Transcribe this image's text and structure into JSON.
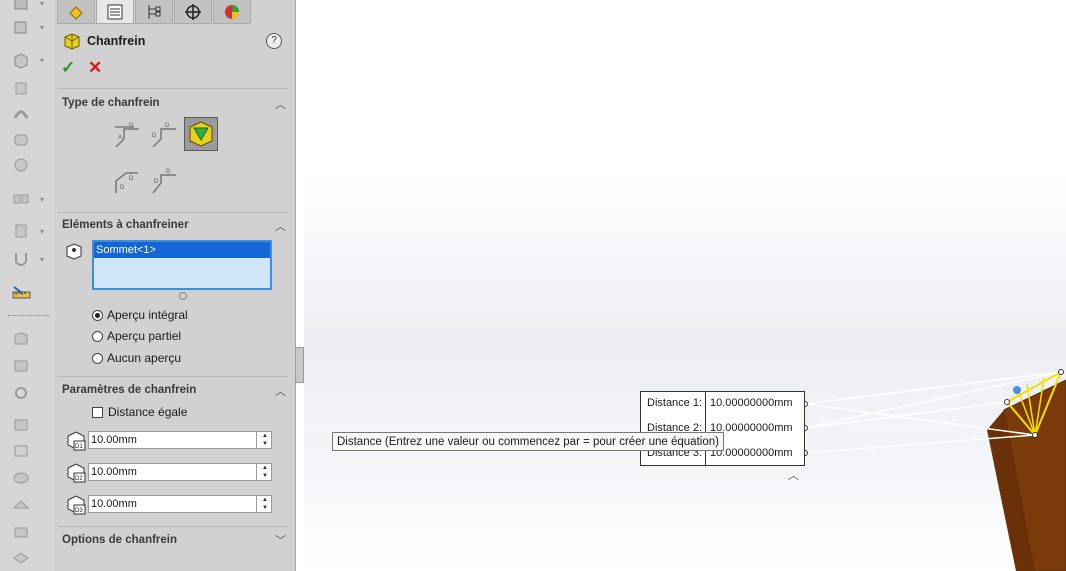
{
  "toolstrip": {
    "icons": [
      "part-icon",
      "box-icon",
      "extrude-icon",
      "revolve-icon",
      "sweep-icon",
      "fillet-icon",
      "pattern-icon",
      "rib-icon",
      "wrap-icon",
      "ruler-icon",
      "shell-icon",
      "draft-icon",
      "loft-icon",
      "hole-icon",
      "mirror-icon",
      "curve-icon",
      "reference-icon",
      "sheet-icon"
    ]
  },
  "tabs": [
    "feature-manager",
    "property-manager",
    "configuration-manager",
    "dimxpert-manager",
    "display-manager"
  ],
  "feature": {
    "title": "Chanfrein",
    "help": "?"
  },
  "sections": {
    "type": {
      "title": "Type de chanfrein"
    },
    "elements": {
      "title": "Eléments à chanfreiner",
      "items": [
        "Sommet<1>"
      ]
    },
    "preview": {
      "options": [
        "Aperçu intégral",
        "Aperçu partiel",
        "Aucun aperçu"
      ],
      "selected": 0
    },
    "params": {
      "title": "Paramètres de chanfrein",
      "equal_distance": "Distance égale",
      "equal_checked": false,
      "values": [
        {
          "icon_label": "D1",
          "value": "10.00mm"
        },
        {
          "icon_label": "D2",
          "value": "10.00mm"
        },
        {
          "icon_label": "D3",
          "value": "10.00mm"
        }
      ]
    },
    "options": {
      "title": "Options de chanfrein"
    }
  },
  "callout": {
    "rows": [
      {
        "label": "Distance 1:",
        "value": "10.00000000mm"
      },
      {
        "label": "Distance 2:",
        "value": "10.00000000mm"
      },
      {
        "label": "Distance 3:",
        "value": "10.00000000mm"
      }
    ]
  },
  "tooltip": "Distance (Entrez une valeur ou commencez par = pour créer une équation)",
  "colors": {
    "part_face": "#7a3a0a",
    "part_edge": "#5a2a05",
    "chamfer_preview": "#f5e000",
    "selected_row": "#1466d6",
    "ok_green": "#2a9a2a",
    "cancel_red": "#d81818"
  }
}
